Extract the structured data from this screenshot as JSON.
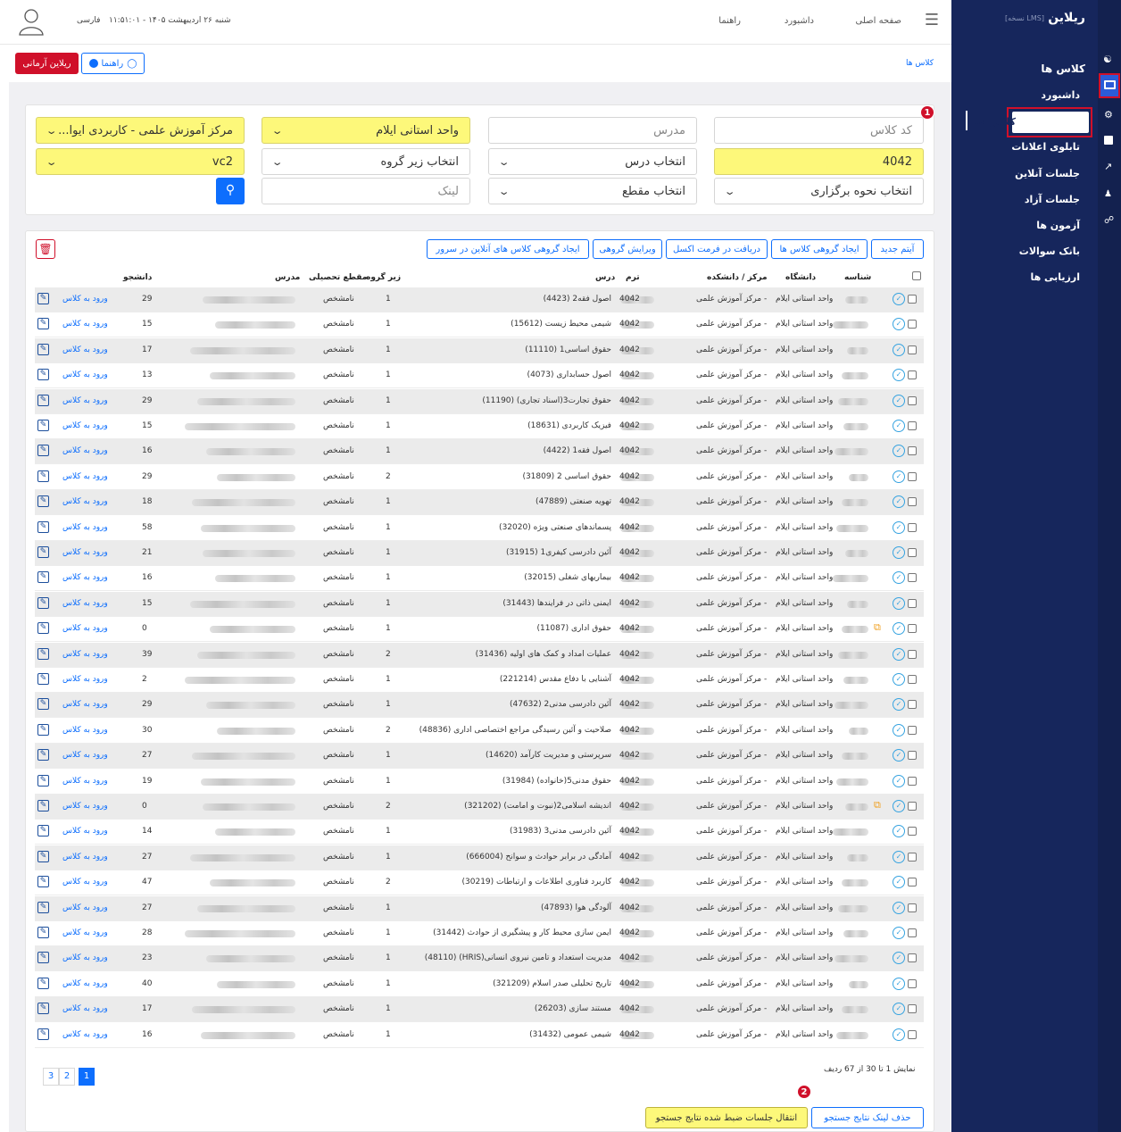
{
  "brand": {
    "logo": "ریلاین",
    "version": "[نسخه LMS]"
  },
  "header": {
    "nav": [
      "صفحه اصلی",
      "داشبورد",
      "راهنما"
    ],
    "datetime": "شنبه ۲۶ اردیبهشت ۱۴۰۵ - ۱۱:۵۱:۰۱",
    "language": "فارسی"
  },
  "breadcrumb": "کلاس ها",
  "buttons": {
    "help": "راهنما",
    "armani": "ریلاین آرمانی"
  },
  "sidebar": {
    "title": "کلاس ها",
    "items": [
      "داشبورد",
      "کلاس ها",
      "تابلوی اعلانات",
      "جلسات آنلاین",
      "جلسات آزاد",
      "آزمون ها",
      "بانک سوالات",
      "ارزیابی ها"
    ]
  },
  "filters": {
    "class_code": "کد کلاس",
    "teacher": "مدرس",
    "province_unit": "واحد استانی ایلام",
    "center": "مرکز آموزش علمی - کاربردی ایوا...",
    "term": "4042",
    "course": "انتخاب درس",
    "subgroup": "انتخاب زیر گروه",
    "vc": "vc2",
    "mode": "انتخاب نحوه برگزاری",
    "level": "انتخاب مقطع",
    "link": "لینک"
  },
  "actions": [
    "آیتم جدید",
    "ایجاد گروهی کلاس ها",
    "دریافت در فرمت اکسل",
    "ویرایش گروهی",
    "ایجاد گروهی کلاس های آنلاین در سرور"
  ],
  "columns": {
    "id": "شناسه",
    "university": "دانشگاه",
    "center": "مرکز / دانشکده",
    "term": "ترم",
    "course": "درس",
    "subgroup": "زیر گروه",
    "level": "مقطع تحصیلی",
    "teacher": "مدرس",
    "students": "دانشجو"
  },
  "row_common": {
    "university": "واحد استانی ایلام",
    "center": "مرکز آموزش علمی -",
    "term": "4042",
    "level": "نامشخص",
    "enter": "ورود به کلاس"
  },
  "rows": [
    {
      "course": "اصول فقه2 (4423)",
      "sg": "1",
      "st": "29"
    },
    {
      "course": "شیمی محیط زیست (15612)",
      "sg": "1",
      "st": "15"
    },
    {
      "course": "حقوق اساسی1 (11110)",
      "sg": "1",
      "st": "17"
    },
    {
      "course": "اصول حسابداری (4073)",
      "sg": "1",
      "st": "13"
    },
    {
      "course": "حقوق تجارت3(اسناد تجاری) (11190)",
      "sg": "1",
      "st": "29"
    },
    {
      "course": "فیزیک کاربردی (18631)",
      "sg": "1",
      "st": "15"
    },
    {
      "course": "اصول فقه1 (4422)",
      "sg": "1",
      "st": "16"
    },
    {
      "course": "حقوق اساسی 2 (31809)",
      "sg": "2",
      "st": "29"
    },
    {
      "course": "تهویه صنعتی (47889)",
      "sg": "1",
      "st": "18"
    },
    {
      "course": "پسماندهای صنعتی ویژه (32020)",
      "sg": "1",
      "st": "58"
    },
    {
      "course": "آئین دادرسی کیفری1 (31915)",
      "sg": "1",
      "st": "21"
    },
    {
      "course": "بیماریهای شغلی (32015)",
      "sg": "1",
      "st": "16"
    },
    {
      "course": "ایمنی ذاتی در فرایندها (31443)",
      "sg": "1",
      "st": "15"
    },
    {
      "course": "حقوق اداری (11087)",
      "sg": "1",
      "st": "0",
      "ext": true
    },
    {
      "course": "عملیات امداد و کمک های اولیه (31436)",
      "sg": "2",
      "st": "39"
    },
    {
      "course": "آشنایی با دفاع مقدس (221214)",
      "sg": "1",
      "st": "2"
    },
    {
      "course": "آئین دادرسی مدنی2 (47632)",
      "sg": "1",
      "st": "29"
    },
    {
      "course": "صلاحیت و آئین رسیدگی مراجع اختصاصی اداری (48836)",
      "sg": "2",
      "st": "30"
    },
    {
      "course": "سرپرستی و مدیریت کارآمد (14620)",
      "sg": "1",
      "st": "27"
    },
    {
      "course": "حقوق مدنی5(خانواده) (31984)",
      "sg": "1",
      "st": "19"
    },
    {
      "course": "اندیشه اسلامی2(نبوت و امامت) (321202)",
      "sg": "2",
      "st": "0",
      "ext": true
    },
    {
      "course": "آئین دادرسی مدنی3 (31983)",
      "sg": "1",
      "st": "14"
    },
    {
      "course": "آمادگی در برابر حوادث و سوانح (666004)",
      "sg": "1",
      "st": "27"
    },
    {
      "course": "کاربرد فناوری اطلاعات و ارتباطات (30219)",
      "sg": "2",
      "st": "47"
    },
    {
      "course": "آلودگی هوا (47893)",
      "sg": "1",
      "st": "27"
    },
    {
      "course": "ایمن سازی محیط کار و پیشگیری از حوادث (31442)",
      "sg": "1",
      "st": "28"
    },
    {
      "course": "مدیریت استعداد و تامین نیروی انسانی(HRIS) (48110)",
      "sg": "1",
      "st": "23"
    },
    {
      "course": "تاریخ تحلیلی صدر اسلام (321209)",
      "sg": "1",
      "st": "40"
    },
    {
      "course": "مستند سازی (26203)",
      "sg": "1",
      "st": "17"
    },
    {
      "course": "شیمی عمومی (31432)",
      "sg": "1",
      "st": "16"
    }
  ],
  "pagination": {
    "summary": "نمایش 1 تا 30 از 67 ردیف",
    "pages": [
      "1",
      "2",
      "3"
    ]
  },
  "bottom": {
    "remove_link": "حذف لینک نتایج جستجو",
    "transfer": "انتقال جلسات ضبط شده نتایج جستجو"
  },
  "markers": [
    "1",
    "2"
  ],
  "colors": {
    "sidebar": "#16265c",
    "accent": "#0d6efd",
    "highlight": "#fdf87a",
    "danger": "#d0102a"
  }
}
